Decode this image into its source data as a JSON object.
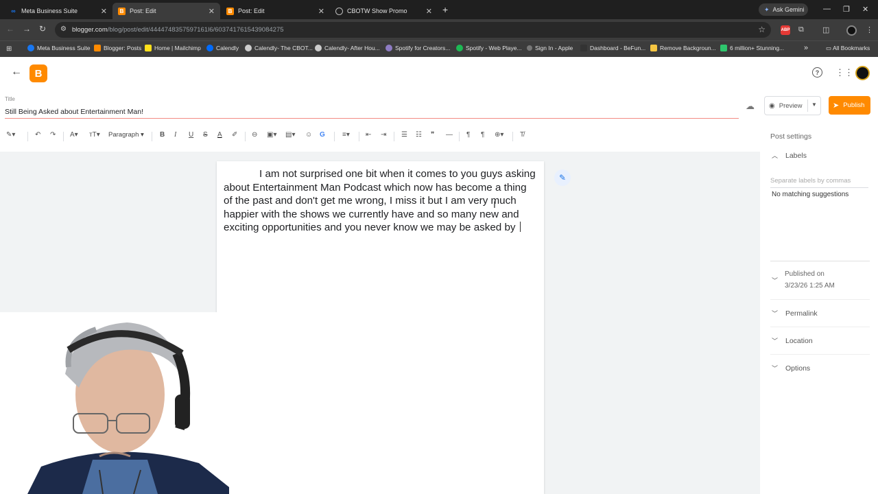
{
  "browser": {
    "tabs": [
      {
        "title": "Meta Business Suite",
        "icon_color": "#1877f2",
        "active": false
      },
      {
        "title": "Post: Edit",
        "icon_color": "#ff8a00",
        "active": true
      },
      {
        "title": "Post: Edit",
        "icon_color": "#ff8a00",
        "active": false
      },
      {
        "title": "CBOTW Show Promo",
        "icon_color": "#9e9e9e",
        "active": false
      }
    ],
    "gemini_label": "Ask Gemini",
    "url_host": "blogger.com",
    "url_path": "/blog/post/edit/4444748357597161l6/6037417615439084275",
    "bookmarks": [
      "Meta Business Suite",
      "Blogger: Posts",
      "Home | Mailchimp",
      "Calendly",
      "Calendly- The CBOT...",
      "Calendly- After Hou...",
      "Spotify for Creators...",
      "Spotify - Web Playe...",
      "Sign In - Apple",
      "Dashboard - BeFun...",
      "Remove Backgroun...",
      "6 million+ Stunning..."
    ],
    "all_bookmarks": "All Bookmarks"
  },
  "editor": {
    "title_label": "Title",
    "title_value": "Still Being Asked about Entertainment Man!",
    "preview_label": "Preview",
    "publish_label": "Publish",
    "paragraph_style": "Paragraph",
    "body_text": "I am not surprised one bit when it comes to you guys asking about Entertainment Man Podcast which now has become a thing of the past and don't get me wrong, I miss it but I am very much happier with the shows we currently have and so many new and exciting opportunities and you never know we may be asked by "
  },
  "settings": {
    "heading": "Post settings",
    "labels_title": "Labels",
    "labels_placeholder": "Separate labels by commas",
    "no_match": "No matching suggestions",
    "published_line1": "Published on",
    "published_line2": "3/23/26 1:25 AM",
    "permalink": "Permalink",
    "location": "Location",
    "options": "Options"
  },
  "colors": {
    "brand_orange": "#ff8a00",
    "title_underline": "#f28b82",
    "chrome_dark": "#1f1f1f"
  }
}
